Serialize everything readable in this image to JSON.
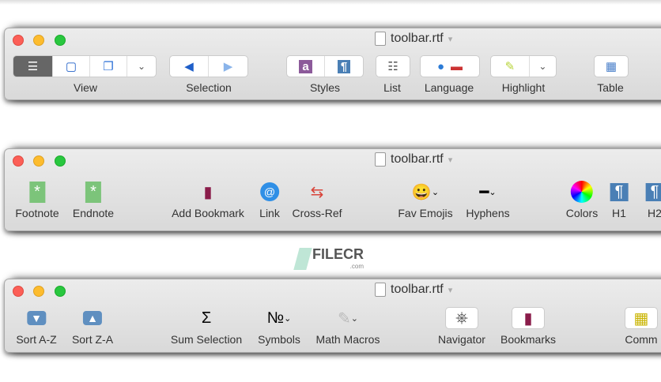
{
  "windows": [
    {
      "title": "toolbar.rtf",
      "groups": [
        "View",
        "Selection",
        "Styles",
        "List",
        "Language",
        "Highlight",
        "Table"
      ]
    },
    {
      "title": "toolbar.rtf",
      "items": [
        "Footnote",
        "Endnote",
        "Add Bookmark",
        "Link",
        "Cross-Ref",
        "Fav Emojis",
        "Hyphens",
        "Colors",
        "H1",
        "H2"
      ]
    },
    {
      "title": "toolbar.rtf",
      "items": [
        "Sort A-Z",
        "Sort Z-A",
        "Sum Selection",
        "Symbols",
        "Math Macros",
        "Navigator",
        "Bookmarks",
        "Comm"
      ]
    }
  ],
  "watermark": {
    "name": "FILECR",
    "suffix": ".com"
  },
  "icons": {
    "sum": "Σ",
    "numero": "№",
    "chevron": "⌄"
  }
}
